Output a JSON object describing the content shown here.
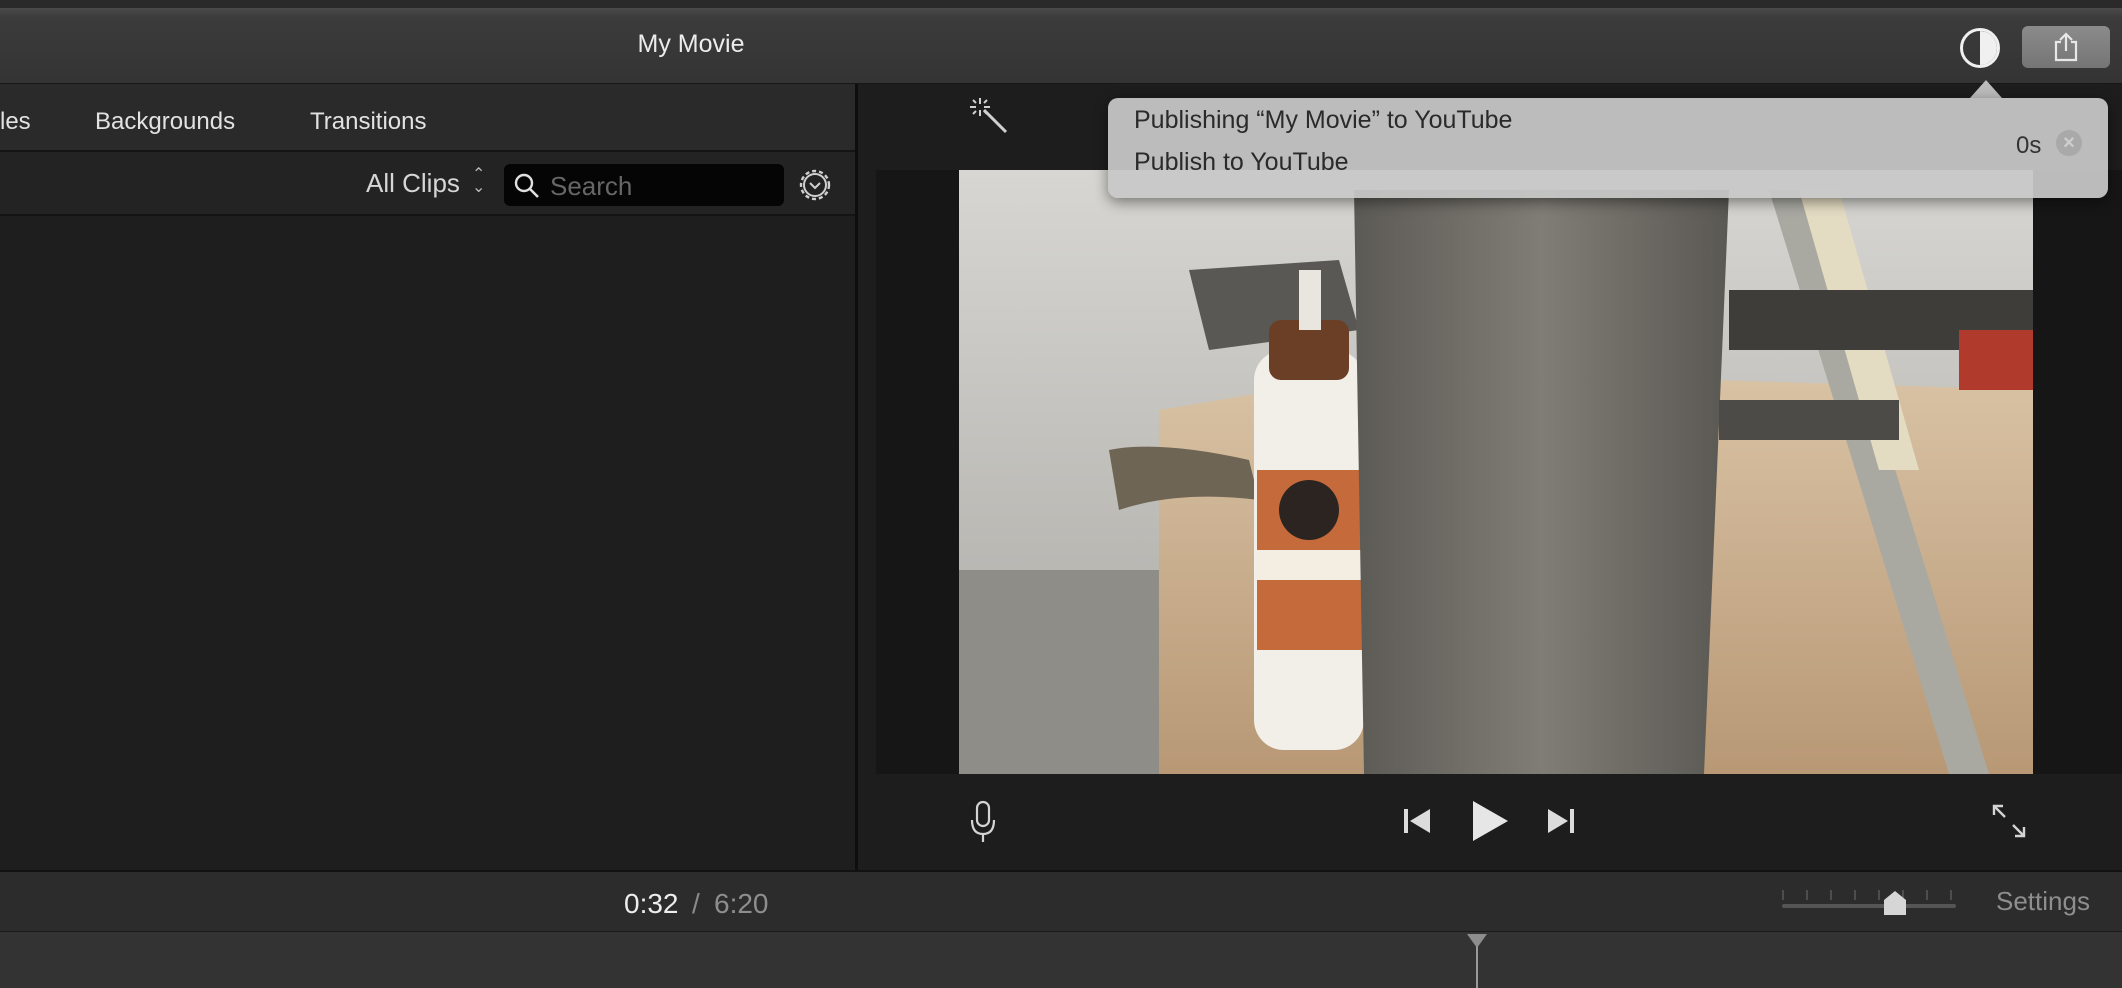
{
  "window": {
    "title": "My Movie"
  },
  "library_tabs": [
    {
      "label": "les"
    },
    {
      "label": "Backgrounds"
    },
    {
      "label": "Transitions"
    }
  ],
  "browser": {
    "filter_label": "All Clips",
    "search_placeholder": "Search",
    "search_value": ""
  },
  "notification": {
    "title": "Publishing “My Movie” to YouTube",
    "subtitle": "Publish to YouTube",
    "elapsed": "0s"
  },
  "viewer": {
    "icons": [
      "magic-wand-icon",
      "microphone-icon",
      "skip-back-icon",
      "play-icon",
      "skip-forward-icon",
      "fullscreen-icon"
    ]
  },
  "timeline": {
    "current_time": "0:32",
    "separator": "/",
    "total_time": "6:20",
    "settings_label": "Settings",
    "zoom_level": 0.7
  },
  "colors": {
    "background": "#1e1e1e",
    "titlebar": "#3b3b3b",
    "popover": "#c8c8c8",
    "text": "#ececec"
  }
}
